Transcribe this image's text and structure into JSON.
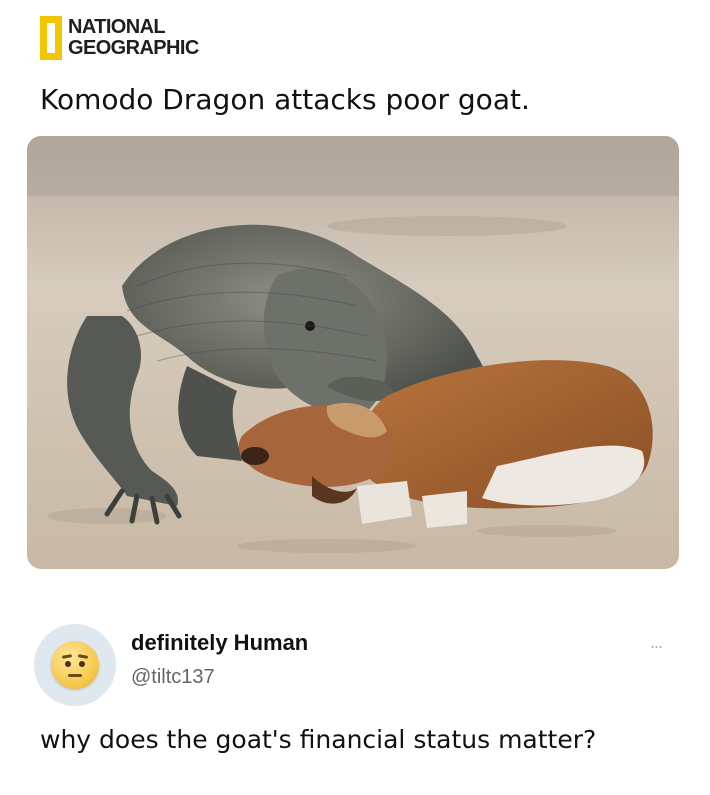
{
  "header": {
    "brand_line1": "NATIONAL",
    "brand_line2": "GEOGRAPHIC",
    "headline": "Komodo Dragon attacks poor goat."
  },
  "photo": {
    "icon": "photo-komodo-dragon-goat"
  },
  "tweet": {
    "display_name": "definitely Human",
    "handle": "@tiltc137",
    "more": "...",
    "text": "why does the goat's financial status matter?",
    "avatar_icon": "worried-face-emoji"
  },
  "colors": {
    "brand_yellow": "#f2c600",
    "text": "#111111",
    "handle": "#666666"
  }
}
